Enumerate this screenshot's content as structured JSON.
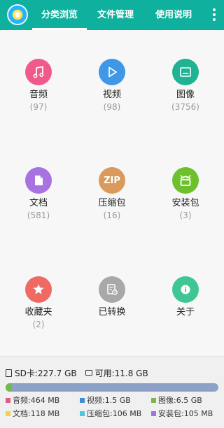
{
  "header": {
    "tabs": [
      {
        "label": "分类浏览"
      },
      {
        "label": "文件管理"
      },
      {
        "label": "使用说明"
      }
    ]
  },
  "categories": [
    {
      "label": "音频",
      "count": "(97)",
      "color": "#ef5a8a",
      "icon": "music-note-icon"
    },
    {
      "label": "视频",
      "count": "(98)",
      "color": "#3e98e6",
      "icon": "play-icon"
    },
    {
      "label": "图像",
      "count": "(3756)",
      "color": "#1fb394",
      "icon": "image-icon"
    },
    {
      "label": "文档",
      "count": "(581)",
      "color": "#a873e0",
      "icon": "document-icon"
    },
    {
      "label": "压缩包",
      "count": "(16)",
      "color": "#d99a5c",
      "icon": "zip-icon",
      "icon_text": "ZIP"
    },
    {
      "label": "安装包",
      "count": "(3)",
      "color": "#6cc12c",
      "icon": "android-icon"
    },
    {
      "label": "收藏夹",
      "count": "(2)",
      "color": "#ee6a63",
      "icon": "star-icon"
    },
    {
      "label": "已转换",
      "count": "",
      "color": "#a8a8a8",
      "icon": "converted-icon"
    },
    {
      "label": "关于",
      "count": "",
      "color": "#3ec794",
      "icon": "info-icon"
    }
  ],
  "storage": {
    "sd_text": "SD卡:227.7 GB",
    "available_text": "可用:11.8 GB",
    "legend": [
      {
        "text": "音频:464 MB",
        "color": "#e05a87"
      },
      {
        "text": "视频:1.5 GB",
        "color": "#3f8fd0"
      },
      {
        "text": "图像:6.5 GB",
        "color": "#76b84a"
      },
      {
        "text": "文档:118 MB",
        "color": "#efd24e"
      },
      {
        "text": "压缩包:106 MB",
        "color": "#4dc6d8"
      },
      {
        "text": "安装包:105 MB",
        "color": "#9b76d8"
      }
    ],
    "bar_segments": [
      {
        "name": "image",
        "fraction": 0.03,
        "color": "#76b84a"
      },
      {
        "name": "used-other",
        "fraction": 0.9,
        "color": "#8da0c6"
      }
    ]
  }
}
